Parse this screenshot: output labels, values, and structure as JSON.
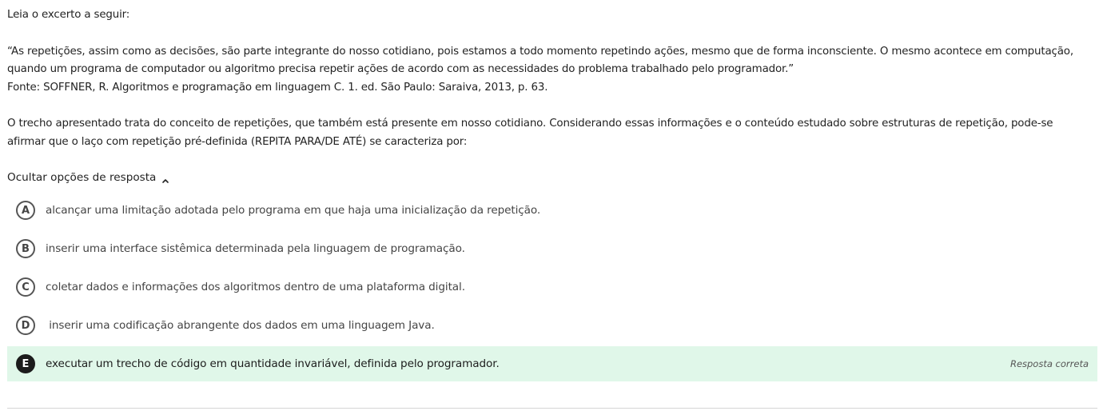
{
  "question": {
    "intro": "Leia o excerto a seguir:",
    "quote": "“As repetições, assim como as decisões, são parte integrante do nosso cotidiano, pois estamos a todo momento repetindo ações, mesmo que de forma inconsciente. O mesmo acontece em computação, quando um programa de computador ou algoritmo precisa repetir ações de acordo com as necessidades do problema trabalhado pelo programador.”",
    "source": "Fonte: SOFFNER, R. Algoritmos e programação em linguagem C. 1. ed. São Paulo: Saraiva, 2013, p. 63.",
    "prompt": "O trecho apresentado trata do conceito de repetições, que também está presente em nosso cotidiano. Considerando essas informações e o conteúdo estudado sobre estruturas de repetição, pode-se afirmar que o laço com repetição pré-definida (REPITA PARA/DE ATÉ) se caracteriza por:"
  },
  "toggle": {
    "label": "Ocultar opções de resposta",
    "icon": "chevron-up-icon"
  },
  "options": [
    {
      "letter": "A",
      "text": "alcançar uma limitação adotada pelo programa em que haja uma inicialização da repetição."
    },
    {
      "letter": "B",
      "text": "inserir uma interface sistêmica determinada pela linguagem de programação."
    },
    {
      "letter": "C",
      "text": "coletar dados e informações dos algoritmos dentro de uma plataforma digital."
    },
    {
      "letter": "D",
      "text": " inserir uma codificação abrangente dos dados em uma linguagem Java."
    },
    {
      "letter": "E",
      "text": "executar um trecho de código em quantidade invariável, definida pelo programador.",
      "status": "Resposta correta"
    }
  ],
  "colors": {
    "correct_background": "#e0f7e9",
    "correct_badge": "#1c1c1c"
  }
}
